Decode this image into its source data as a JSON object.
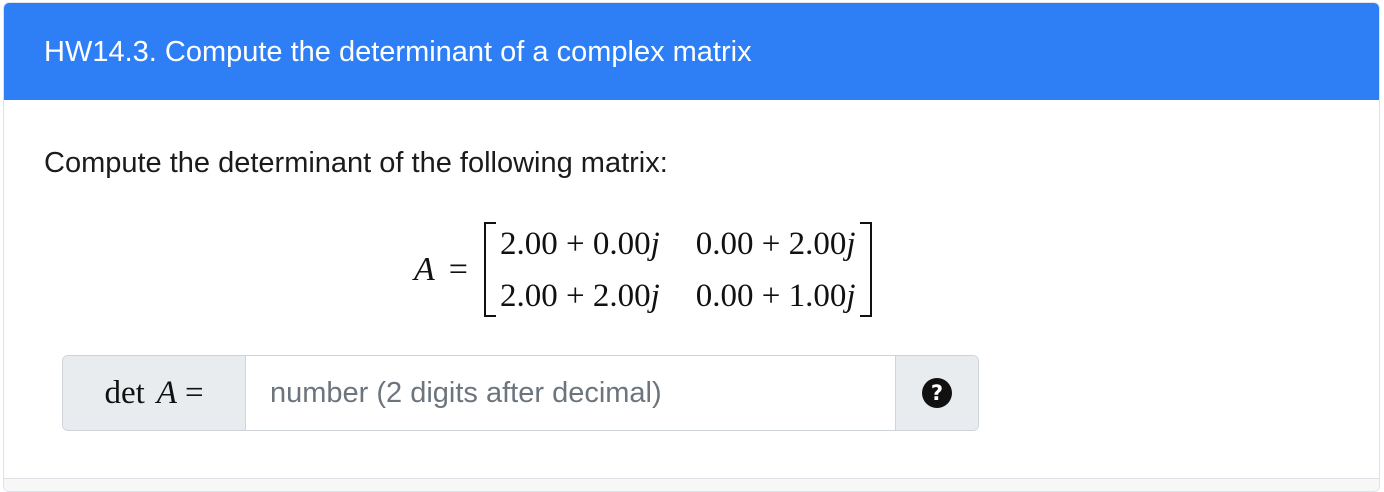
{
  "header": {
    "title": "HW14.3. Compute the determinant of a complex matrix"
  },
  "body": {
    "prompt": "Compute the determinant of the following matrix:",
    "equation": {
      "lhs": "A",
      "equals": "=",
      "matrix": [
        [
          "2.00 + 0.00",
          "0.00 + 2.00"
        ],
        [
          "2.00 + 2.00",
          "0.00 + 1.00"
        ]
      ],
      "imag_unit": "j"
    }
  },
  "answer": {
    "label_prefix": "det",
    "label_var": "A",
    "label_equals": "=",
    "placeholder": "number (2 digits after decimal)",
    "value": "",
    "help_icon": "question-circle-icon",
    "help_glyph": "?"
  },
  "colors": {
    "header_bg": "#2e7ff6",
    "header_text": "#ffffff",
    "addon_bg": "#e9ecef"
  }
}
